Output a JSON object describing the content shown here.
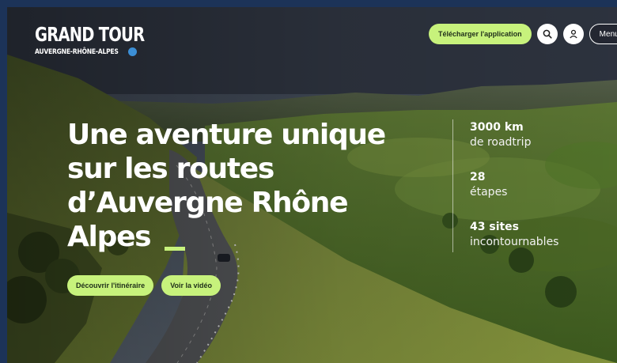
{
  "header": {
    "logo_title": "GRAND TOUR",
    "logo_subtitle": "AUVERGNE-RHÔNE-ALPES",
    "download_app_label": "Télécharger l'application",
    "menu_label": "Menu",
    "icons": [
      "search-icon",
      "user-icon"
    ]
  },
  "hero": {
    "headline_lines": [
      "Une aventure unique",
      "sur les routes",
      "d’Auvergne Rhône",
      "Alpes"
    ],
    "cta_primary_label": "Découvrir l'itinéraire",
    "cta_secondary_label": "Voir la vidéo"
  },
  "stats": [
    {
      "value": "3000 km",
      "label": "de roadtrip"
    },
    {
      "value": "28",
      "label": "étapes"
    },
    {
      "value": "43 sites",
      "label": "incontournables"
    }
  ],
  "colors": {
    "accent": "#c7f27c",
    "frame": "#1c3358",
    "text": "#ffffff"
  }
}
